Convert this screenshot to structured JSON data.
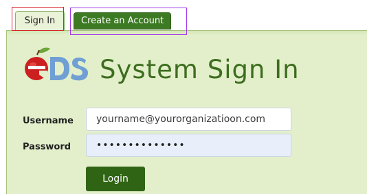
{
  "tabs": {
    "sign_in_label": "Sign In",
    "create_account_label": "Create an Account"
  },
  "logo": {
    "text": "eDS",
    "icon": "apple-logo-icon"
  },
  "heading": {
    "title": "System Sign In"
  },
  "form": {
    "username_label": "Username",
    "username_value": "yourname@yourorganizatioon.com",
    "password_label": "Password",
    "password_value": "••••••••••••••",
    "login_label": "Login"
  },
  "colors": {
    "panel_background": "#e3efcb",
    "brand_green": "#3d6d1f",
    "button_green": "#2f6414",
    "logo_red": "#cc1f1f",
    "annotation_red": "#d7232a",
    "annotation_purple": "#a238e8"
  }
}
